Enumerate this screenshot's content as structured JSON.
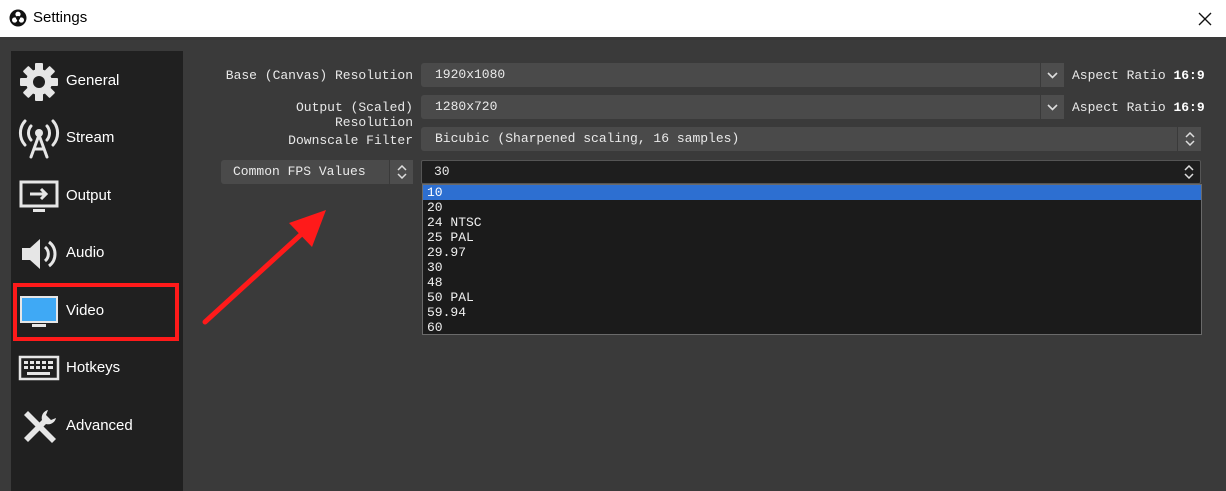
{
  "window": {
    "title": "Settings"
  },
  "sidebar": {
    "items": [
      {
        "label": "General",
        "icon": "gear-icon"
      },
      {
        "label": "Stream",
        "icon": "broadcast-antenna-icon"
      },
      {
        "label": "Output",
        "icon": "output-monitor-icon"
      },
      {
        "label": "Audio",
        "icon": "speaker-icon"
      },
      {
        "label": "Video",
        "icon": "monitor-icon"
      },
      {
        "label": "Hotkeys",
        "icon": "keyboard-icon"
      },
      {
        "label": "Advanced",
        "icon": "tools-icon"
      }
    ],
    "selected": "Video"
  },
  "video": {
    "base_label": "Base (Canvas) Resolution",
    "base_value": "1920x1080",
    "base_aspect_label": "Aspect Ratio",
    "base_aspect_value": "16:9",
    "output_label": "Output (Scaled) Resolution",
    "output_value": "1280x720",
    "output_aspect_label": "Aspect Ratio",
    "output_aspect_value": "16:9",
    "filter_label": "Downscale Filter",
    "filter_value": "Bicubic (Sharpened scaling, 16 samples)",
    "fps_type_value": "Common FPS Values",
    "fps_value": "30",
    "fps_options": [
      "10",
      "20",
      "24 NTSC",
      "25 PAL",
      "29.97",
      "30",
      "48",
      "50 PAL",
      "59.94",
      "60"
    ],
    "fps_highlighted": "10"
  },
  "colors": {
    "window_bg": "#3a3a3a",
    "sidebar_bg": "#202020",
    "highlight": "#2d6fd1",
    "annotation_red": "#ff1a1a"
  }
}
